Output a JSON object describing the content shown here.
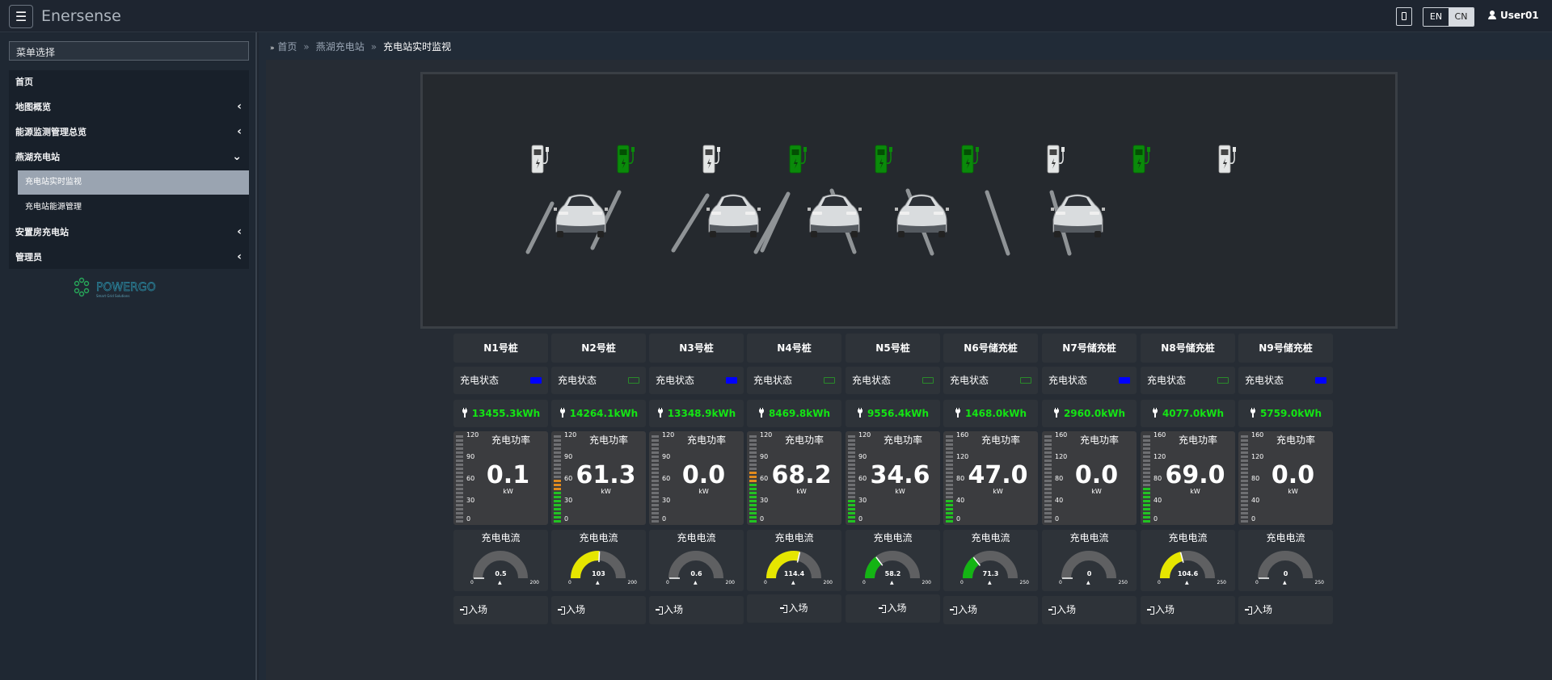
{
  "header": {
    "brand": "Enersense",
    "lang_en": "EN",
    "lang_cn": "CN",
    "user": "User01"
  },
  "sidebar": {
    "menu_label": "菜单选择",
    "items": [
      {
        "label": "首页",
        "chevron": ""
      },
      {
        "label": "地图概览",
        "chevron": "‹"
      },
      {
        "label": "能源监测管理总览",
        "chevron": "‹"
      },
      {
        "label": "燕湖充电站",
        "chevron": "⌄"
      },
      {
        "label": "安置房充电站",
        "chevron": "‹"
      },
      {
        "label": "管理员",
        "chevron": "‹"
      }
    ],
    "sub_items": [
      "充电站实时监视",
      "充电站能源管理"
    ],
    "logo_text": "POWERGO",
    "logo_sub": "Smart Grid Solutions"
  },
  "breadcrumb": {
    "home": "首页",
    "station": "燕湖充电站",
    "current": "充电站实时监视",
    "sep": "»"
  },
  "labels": {
    "state": "充电状态",
    "power": "充电功率",
    "current": "充电电流",
    "unit": "kW",
    "enter": "入场"
  },
  "colors": {
    "green": "#14e414",
    "yellow": "#e6e600",
    "gauge_bg": "#5f6062",
    "blue_led": "#0000ff",
    "orange_seg": "#e08a1e",
    "green_seg": "#22c322"
  },
  "piles": [
    {
      "name": "N1号桩",
      "state": "blue",
      "energy": "13455.3kWh",
      "power": "0.1",
      "power_ticks": [
        "120",
        "90",
        "60",
        "30",
        "0"
      ],
      "power_frac": 0.0,
      "current": "0.5",
      "cur_max": "200",
      "cur_frac": 0.0,
      "color": "#5f6062",
      "charger": "white"
    },
    {
      "name": "N2号桩",
      "state": "green",
      "energy": "14264.1kWh",
      "power": "61.3",
      "power_ticks": [
        "120",
        "90",
        "60",
        "30",
        "0"
      ],
      "power_frac": 0.51,
      "current": "103",
      "cur_max": "200",
      "cur_frac": 0.515,
      "color": "#e6e600",
      "charger": "green"
    },
    {
      "name": "N3号桩",
      "state": "blue",
      "energy": "13348.9kWh",
      "power": "0.0",
      "power_ticks": [
        "120",
        "90",
        "60",
        "30",
        "0"
      ],
      "power_frac": 0.0,
      "current": "0.6",
      "cur_max": "200",
      "cur_frac": 0.0,
      "color": "#5f6062",
      "charger": "white"
    },
    {
      "name": "N4号桩",
      "state": "green",
      "energy": "8469.8kWh",
      "power": "68.2",
      "power_ticks": [
        "120",
        "90",
        "60",
        "30",
        "0"
      ],
      "power_frac": 0.57,
      "current": "114.4",
      "cur_max": "200",
      "cur_frac": 0.572,
      "color": "#e6e600",
      "charger": "green"
    },
    {
      "name": "N5号桩",
      "state": "green",
      "energy": "9556.4kWh",
      "power": "34.6",
      "power_ticks": [
        "120",
        "90",
        "60",
        "30",
        "0"
      ],
      "power_frac": 0.29,
      "current": "58.2",
      "cur_max": "200",
      "cur_frac": 0.291,
      "color": "#14b414",
      "charger": "green"
    },
    {
      "name": "N6号储充桩",
      "state": "green",
      "energy": "1468.0kWh",
      "power": "47.0",
      "power_ticks": [
        "160",
        "120",
        "80",
        "40",
        "0"
      ],
      "power_frac": 0.29,
      "current": "71.3",
      "cur_max": "250",
      "cur_frac": 0.285,
      "color": "#14b414",
      "charger": "green"
    },
    {
      "name": "N7号储充桩",
      "state": "blue",
      "energy": "2960.0kWh",
      "power": "0.0",
      "power_ticks": [
        "160",
        "120",
        "80",
        "40",
        "0"
      ],
      "power_frac": 0.0,
      "current": "0",
      "cur_max": "250",
      "cur_frac": 0.0,
      "color": "#5f6062",
      "charger": "white"
    },
    {
      "name": "N8号储充桩",
      "state": "green",
      "energy": "4077.0kWh",
      "power": "69.0",
      "power_ticks": [
        "160",
        "120",
        "80",
        "40",
        "0"
      ],
      "power_frac": 0.43,
      "current": "104.6",
      "cur_max": "250",
      "cur_frac": 0.418,
      "color": "#e6e600",
      "charger": "green"
    },
    {
      "name": "N9号储充桩",
      "state": "blue",
      "energy": "5759.0kWh",
      "power": "0.0",
      "power_ticks": [
        "160",
        "120",
        "80",
        "40",
        "0"
      ],
      "power_frac": 0.0,
      "current": "0",
      "cur_max": "250",
      "cur_frac": 0.0,
      "color": "#5f6062",
      "charger": "white"
    }
  ]
}
